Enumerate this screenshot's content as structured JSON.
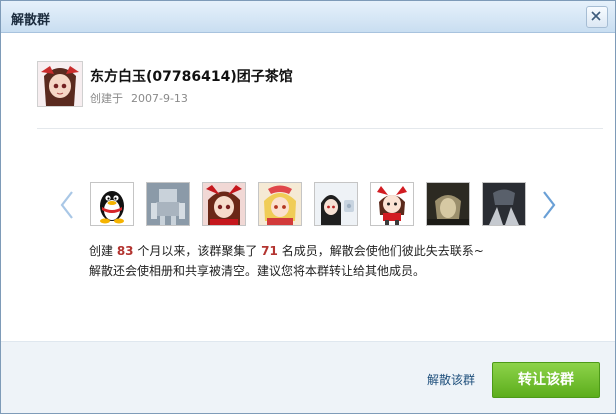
{
  "dialog": {
    "title": "解散群"
  },
  "group": {
    "name": "东方白玉(07786414)团子茶馆",
    "created_label": "创建于",
    "created_date": "2007-9-13"
  },
  "members": [
    {
      "type": "penguin"
    },
    {
      "type": "robot"
    },
    {
      "type": "girl-red"
    },
    {
      "type": "girl-blonde"
    },
    {
      "type": "girl-dark"
    },
    {
      "type": "girl-chibi"
    },
    {
      "type": "man-dark"
    },
    {
      "type": "hands-dark"
    }
  ],
  "description": {
    "line1_pre": "创建 ",
    "months": "83",
    "line1_mid": " 个月以来，该群聚集了 ",
    "members": "71",
    "line1_post": " 名成员，解散会使他们彼此失去联系~",
    "line2": "解散还会使相册和共享被清空。建议您将本群转让给其他成员。"
  },
  "actions": {
    "dismiss_link": "解散该群",
    "transfer_button": "转让该群"
  },
  "colors": {
    "accent_number": "#b33430",
    "primary_button": "#6fbd2c",
    "link": "#1d4e7b"
  }
}
